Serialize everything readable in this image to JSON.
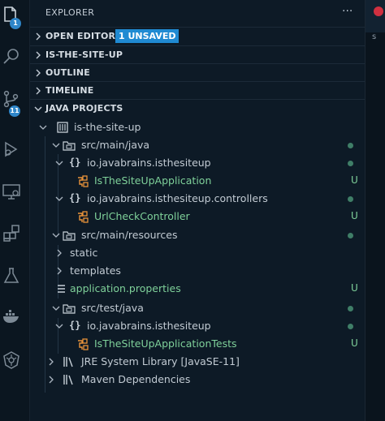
{
  "activity_bar": {
    "items": [
      {
        "icon": "files-icon",
        "badge": "1"
      },
      {
        "icon": "search-icon"
      },
      {
        "icon": "source-control-icon",
        "badge": "11"
      },
      {
        "icon": "run-debug-icon"
      },
      {
        "icon": "remote-explorer-icon"
      },
      {
        "icon": "extensions-icon"
      },
      {
        "icon": "testing-flask-icon"
      },
      {
        "icon": "docker-icon"
      },
      {
        "icon": "kubernetes-icon"
      }
    ]
  },
  "sidebar": {
    "title": "EXPLORER",
    "more_label": "···",
    "sections": {
      "open_editors": {
        "label": "OPEN EDITORS",
        "badge": "1 UNSAVED"
      },
      "workspace": {
        "label": "IS-THE-SITE-UP"
      },
      "outline": {
        "label": "OUTLINE"
      },
      "timeline": {
        "label": "TIMELINE"
      },
      "java_projects": {
        "label": "JAVA PROJECTS"
      }
    },
    "tree": [
      {
        "name": "is-the-site-up",
        "icon": "project-icon",
        "status": ""
      },
      {
        "name": "src/main/java",
        "icon": "source-folder-icon",
        "status": "dot"
      },
      {
        "name": "io.javabrains.isthesiteup",
        "icon": "package-icon",
        "status": "dot"
      },
      {
        "name": "IsTheSiteUpApplication",
        "icon": "java-class-icon",
        "status": "U"
      },
      {
        "name": "io.javabrains.isthesiteup.controllers",
        "icon": "package-icon",
        "status": "dot"
      },
      {
        "name": "UrlCheckController",
        "icon": "java-class-icon",
        "status": "U"
      },
      {
        "name": "src/main/resources",
        "icon": "source-folder-icon",
        "status": "dot"
      },
      {
        "name": "static",
        "icon": "",
        "status": ""
      },
      {
        "name": "templates",
        "icon": "",
        "status": ""
      },
      {
        "name": "application.properties",
        "icon": "properties-file-icon",
        "status": "U"
      },
      {
        "name": "src/test/java",
        "icon": "source-folder-icon",
        "status": "dot"
      },
      {
        "name": "io.javabrains.isthesiteup",
        "icon": "package-icon",
        "status": "dot"
      },
      {
        "name": "IsTheSiteUpApplicationTests",
        "icon": "java-class-icon",
        "status": "U"
      },
      {
        "name": "JRE System Library [JavaSE-11]",
        "icon": "library-icon",
        "status": ""
      },
      {
        "name": "Maven Dependencies",
        "icon": "library-icon",
        "status": ""
      }
    ]
  },
  "editor": {
    "tab_letter": "s"
  }
}
